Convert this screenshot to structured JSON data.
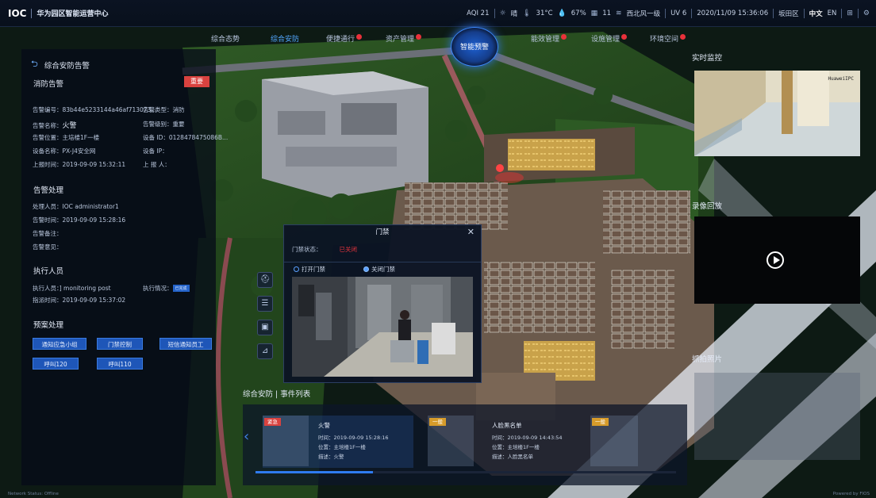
{
  "app": {
    "logo_text": "IOC",
    "title": "华为园区智能运营中心"
  },
  "status_bar": {
    "aqi": "AQI 21",
    "weather": "晴",
    "temperature": "31°C",
    "humidity": "67%",
    "pm": "11",
    "wind": "西北风一级",
    "uv": "UV 6",
    "datetime": "2020/11/09 15:36:06",
    "district": "坂田区",
    "lang_zh": "中文",
    "lang_en": "EN",
    "icons": [
      "sun-icon",
      "thermometer-icon",
      "humidity-icon",
      "pm-icon",
      "wind-icon",
      "settings-icon"
    ]
  },
  "nav": {
    "center": "智能预警",
    "tabs": [
      {
        "label": "综合态势",
        "badge": false
      },
      {
        "label": "综合安防",
        "badge": false,
        "active": true
      },
      {
        "label": "便捷通行",
        "badge": true
      },
      {
        "label": "资产管理",
        "badge": true
      },
      {
        "label": "能效管理",
        "badge": true
      },
      {
        "label": "设施管理",
        "badge": true
      },
      {
        "label": "环境空间",
        "badge": true
      }
    ]
  },
  "left": {
    "back_label": "综合安防告警",
    "alarm_section": "消防告警",
    "importance": "重要",
    "alarm_no": "告警编号：83b44e5233144a46af713073...",
    "alarm_type": "告警类型：消防",
    "alarm_name_k": "告警名称：",
    "alarm_name_v": "火警",
    "alarm_level": "告警级别：重要",
    "alarm_location": "告警位置：主培楼1F一楼",
    "device_id": "设备 ID：0128478475086B...",
    "device_name": "设备名称：PX-J4安全网",
    "device_ip": "设备 IP：",
    "report_time": "上报时间：2019-09-09 15:32:11",
    "reporter": "上 报 人：",
    "handling_section": "告警处理",
    "handler": "处理人员：IOC administrator1",
    "handle_time": "告警时间：2019-09-09 15:28:16",
    "remark": "告警备注：",
    "opinion": "告警意见：",
    "exec_section": "执行人员",
    "executor": "执行人员：] monitoring post",
    "exec_status_k": "执行情况：",
    "exec_status_v": "已完成",
    "dispatch_time": "指派时间：2019-09-09 15:37:02",
    "plan_section": "预案处理",
    "buttons": [
      "通知应急小组",
      "门禁控制",
      "短信通知员工",
      "呼叫120",
      "呼叫110"
    ]
  },
  "dialog": {
    "title": "门禁",
    "state_label": "门禁状态：",
    "state_value": "已关闭",
    "open_label": "打开门禁",
    "close_label": "关闭门禁",
    "selected": "close"
  },
  "right": {
    "live_title": "实时监控",
    "cam_watermark": "HuaweiIPC",
    "playback_title": "录像回放",
    "snapshot_title": "抓拍照片"
  },
  "events": {
    "title": "综合安防 | 事件列表",
    "items": [
      {
        "level": "紧急",
        "level_color": "#d9423f",
        "name": "火警",
        "time": "时间：2019-09-09 15:28:16",
        "location": "位置：主培楼1F一楼",
        "desc": "描述：火警"
      },
      {
        "level": "一般",
        "level_color": "#d69b2a",
        "name": "",
        "time": "",
        "location": "",
        "desc": ""
      },
      {
        "level": "一般",
        "level_color": "#d69b2a",
        "name": "人脸黑名单",
        "time": "时间：2019-09-09 14:43:54",
        "location": "位置：主培楼1F一楼",
        "desc": "描述：人脸黑名单"
      },
      {
        "level": "一般",
        "level_color": "#d69b2a",
        "name": "",
        "time": "",
        "location": "",
        "desc": ""
      }
    ],
    "progress": 0.28
  },
  "footer": {
    "left": "Network Status: Offline",
    "right": "Powered by FIOS"
  }
}
